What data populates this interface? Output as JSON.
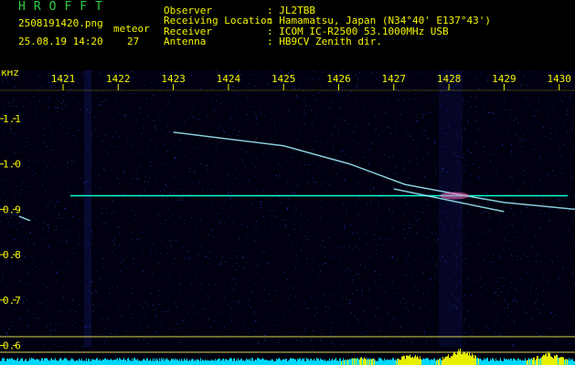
{
  "header": {
    "brand": "HROFFT",
    "filename": "2508191420.png",
    "datetime": "25.08.19 14:20",
    "meteor_label": "meteor",
    "meteor_count": "27",
    "info": [
      {
        "label": "Observer",
        "value": ": JL2TBB"
      },
      {
        "label": "Receiving Location",
        "value": ": Hamamatsu, Japan (N34°40' E137°43')"
      },
      {
        "label": "Receiver",
        "value": ": ICOM IC-R2500 53.1000MHz USB"
      },
      {
        "label": "Antenna",
        "value": ": HB9CV Zenith dir."
      }
    ]
  },
  "chart_data": {
    "type": "heatmap",
    "xlabel": "",
    "ylabel": "kHz",
    "x_ticks": [
      "1421",
      "1422",
      "1423",
      "1424",
      "1425",
      "1426",
      "1427",
      "1428",
      "1429",
      "1430"
    ],
    "y_ticks": [
      "1.1",
      "1.0",
      "0.9",
      "0.8",
      "0.7",
      "0.6"
    ],
    "x_range": [
      1420.3,
      1430.3
    ],
    "y_range": [
      0.575,
      1.2
    ],
    "carrier_khz": 0.93,
    "traces": [
      {
        "points": [
          [
            1423.0,
            1.07
          ],
          [
            1425.0,
            1.04
          ],
          [
            1426.2,
            1.0
          ],
          [
            1427.2,
            0.955
          ],
          [
            1428.3,
            0.93
          ],
          [
            1429.0,
            0.915
          ],
          [
            1430.3,
            0.9
          ]
        ]
      },
      {
        "points": [
          [
            1427.0,
            0.945
          ],
          [
            1428.0,
            0.92
          ],
          [
            1429.0,
            0.895
          ]
        ]
      },
      {
        "points": [
          [
            1420.2,
            0.885
          ],
          [
            1420.4,
            0.875
          ]
        ]
      }
    ],
    "colors": {
      "background": "#000010",
      "noise": "#2a30c8",
      "trace": "#9ff0ff",
      "hot": "#ff70c0",
      "carrier": "#00ffd0",
      "baseline": "#d8d850",
      "signal_bars": "#e8f000",
      "noise_bars": "#00d8ff"
    }
  }
}
